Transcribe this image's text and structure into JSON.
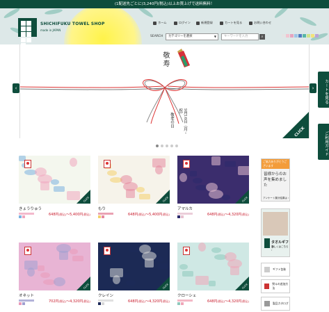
{
  "announcement": "(1配送先ごとに)3,240円(税込)以上お買上げで送料無料！",
  "header": {
    "logo_alt": "SHICHIFUKU TOWEL SHOP logo",
    "shop_name": "SHICHIFUKU TOWEL SHOP",
    "made_in": "made in JAPAN",
    "nav": [
      {
        "label": "ホーム",
        "icon": "home-icon"
      },
      {
        "label": "ログイン",
        "icon": "lock-icon"
      },
      {
        "label": "新規登録",
        "icon": "pen-icon"
      },
      {
        "label": "カートを見る",
        "icon": "cart-icon"
      },
      {
        "label": "お問い合わせ",
        "icon": "mail-icon"
      }
    ],
    "search": {
      "label": "SEARCH",
      "category_placeholder": "カテゴリーを選択",
      "keyword_placeholder": "キーワードを入力"
    },
    "color_swatches": [
      "#e4e4e4",
      "#f2c4d0",
      "#e6a4bf",
      "#9fc4e6",
      "#4f7bc0",
      "#58b7a6",
      "#cfe48a",
      "#f3e27a",
      "#bba4d6"
    ]
  },
  "hero": {
    "title": "敬寿",
    "date": "9月16日（月・祝）",
    "event": "敬老の日",
    "click_label": "CLICK",
    "prev": "‹",
    "next": "›",
    "dots": 5,
    "active_dot": 0
  },
  "side_tabs": {
    "cart": "カートを見る",
    "guide": "ご利用ガイド"
  },
  "products": [
    {
      "name": "きょうりゅう",
      "price": "648円",
      "price_tax": "(税込)",
      "price2": "〜5,400円",
      "price2_tax": "(税込)",
      "click": "CLICK",
      "colors": [
        "#7bb3e0",
        "#f0a7bf"
      ],
      "bg": "#f4f7ee"
    },
    {
      "name": "もり",
      "price": "648円",
      "price_tax": "(税込)",
      "price2": "〜5,400円",
      "price2_tax": "(税込)",
      "click": "CLICK",
      "colors": [
        "#f4d06b",
        "#e58ba0"
      ],
      "bg": "#f6f3ea"
    },
    {
      "name": "アマルカ",
      "price": "648円",
      "price_tax": "(税込)",
      "price2": "〜4,320円",
      "price2_tax": "(税込)",
      "click": "CLICK",
      "colors": [
        "#2b2a6b",
        "#e6c0cf"
      ],
      "bg": "#3b2d6d"
    },
    {
      "name": "オネット",
      "price": "702円",
      "price_tax": "(税込)",
      "price2": "〜4,320円",
      "price2_tax": "(税込)",
      "click": "CLICK",
      "colors": [
        "#e99ab8",
        "#a0a0d0"
      ],
      "bg": "#e8b4d4"
    },
    {
      "name": "クレイン",
      "price": "648円",
      "price_tax": "(税込)",
      "price2": "〜4,320円",
      "price2_tax": "(税込)",
      "click": "CLICK",
      "colors": [
        "#1e2a5a",
        "#d8d8d8"
      ],
      "bg": "#1c2a55"
    },
    {
      "name": "クローシェ",
      "price": "648円",
      "price_tax": "(税込)",
      "price2": "〜4,320円",
      "price2_tax": "(税込)",
      "click": "CLICK",
      "colors": [
        "#8ec8bc",
        "#f0a6b8"
      ],
      "bg": "#cfe8e4"
    }
  ],
  "sidebar": {
    "voice_header": "ご協力ありがとうございます",
    "voice_text": "皆様からのお声を集めました",
    "voice_footer": "アンケート集計結果は ›",
    "gift_label": "タオルギフト",
    "gift_sub": "詳しくはこちら ›",
    "links": [
      {
        "label": "ギフト包装"
      },
      {
        "label": "熨斗の追加方法"
      },
      {
        "label": "製品カタログ"
      }
    ]
  }
}
